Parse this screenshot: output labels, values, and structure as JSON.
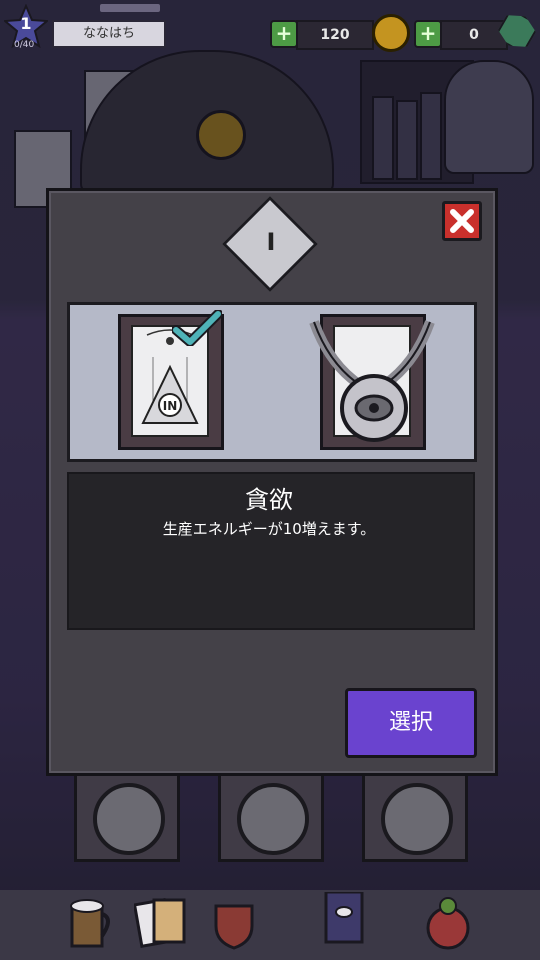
{
  "hud": {
    "level": "1",
    "level_progress": "0/40",
    "player_name": "ななはち",
    "energy": "120",
    "gems": "0",
    "plus_label": "+"
  },
  "modal": {
    "tier": "I",
    "close_icon": "close-icon",
    "title": "貪欲",
    "description": "生産エネルギーが10増えます。",
    "select_label": "選択",
    "cards": [
      {
        "name": "greed-card",
        "state": "selected",
        "glyph": "IN"
      },
      {
        "name": "locked-card",
        "state": "locked"
      }
    ]
  },
  "colors": {
    "accent": "#6a43cf",
    "close": "#c9302c",
    "plus": "#4d9b45",
    "check": "#4fb3b8"
  },
  "nav": [
    "beer-mug-icon",
    "cards-icon",
    "shield-icon",
    "card-deck-icon",
    "globe-icon"
  ]
}
